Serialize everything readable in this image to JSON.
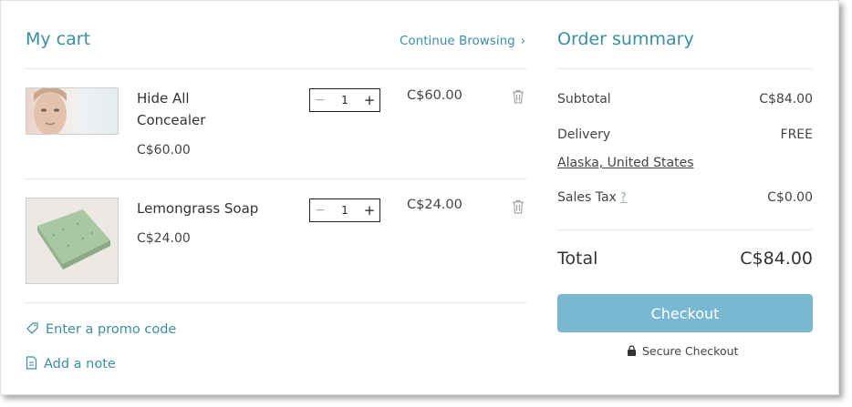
{
  "cart": {
    "title": "My cart",
    "continue_label": "Continue Browsing",
    "items": [
      {
        "name_line1": "Hide All",
        "name_line2": "Concealer",
        "unit_price": "C$60.00",
        "quantity": "1",
        "line_total": "C$60.00"
      },
      {
        "name_line1": "Lemongrass Soap",
        "unit_price": "C$24.00",
        "quantity": "1",
        "line_total": "C$24.00"
      }
    ],
    "promo_label": "Enter a promo code",
    "note_label": "Add a note"
  },
  "summary": {
    "title": "Order summary",
    "subtotal_label": "Subtotal",
    "subtotal_value": "C$84.00",
    "delivery_label": "Delivery",
    "delivery_value": "FREE",
    "location": "Alaska, United States",
    "tax_label": "Sales Tax",
    "tax_help": "?",
    "tax_value": "C$0.00",
    "total_label": "Total",
    "total_value": "C$84.00",
    "checkout_label": "Checkout",
    "secure_label": "Secure Checkout"
  },
  "colors": {
    "accent": "#3a8ea0",
    "checkout_button": "#79b8d1",
    "divider": "#dde8ec"
  }
}
